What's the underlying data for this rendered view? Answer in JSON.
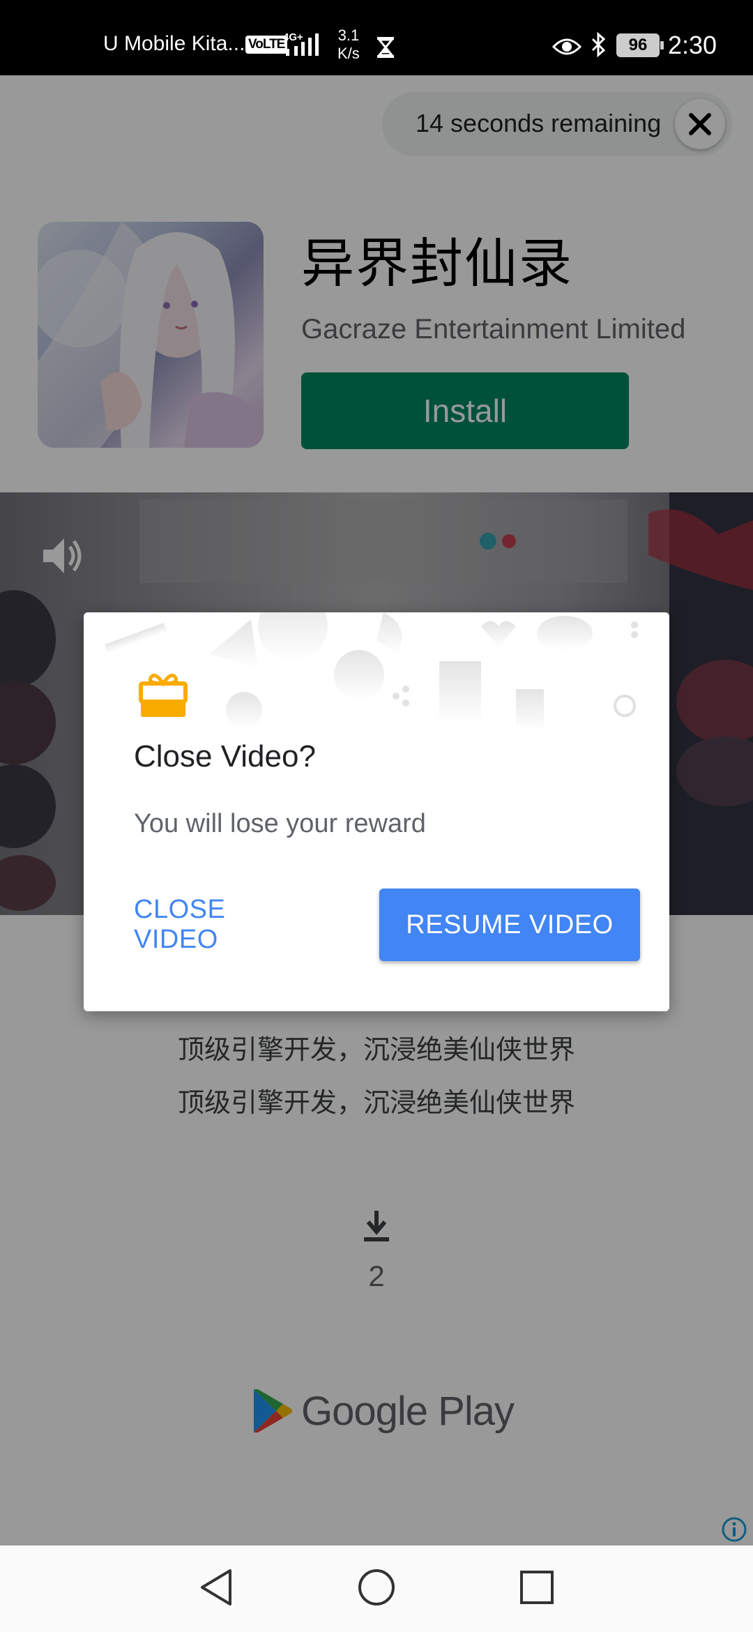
{
  "status_bar": {
    "carrier": "U Mobile Kita...",
    "volte": "VoLTE",
    "network": "4G+",
    "speed_value": "3.1",
    "speed_unit": "K/s",
    "battery": "96",
    "time": "2:30"
  },
  "ad": {
    "timer_text": "14 seconds remaining",
    "app_title": "异界封仙录",
    "developer": "Gacraze Entertainment Limited",
    "install_label": "Install",
    "description_lines": [
      "顶级引擎开发，沉浸绝美仙侠世界",
      "顶级引擎开发，沉浸绝美仙侠世界"
    ],
    "download_count": "2",
    "store_label": "Google Play"
  },
  "dialog": {
    "title": "Close Video?",
    "message": "You will lose your reward",
    "close_label": "CLOSE VIDEO",
    "resume_label": "RESUME VIDEO"
  },
  "colors": {
    "install_green": "#01875f",
    "accent_blue": "#4285f4",
    "gift_yellow": "#f9ab00"
  },
  "icons": [
    "volte-icon",
    "signal-icon",
    "hourglass-icon",
    "eye-icon",
    "bluetooth-icon",
    "battery-icon",
    "close-icon",
    "speaker-icon",
    "gift-icon",
    "download-icon",
    "google-play-logo-icon",
    "ad-info-icon",
    "back-icon",
    "home-icon",
    "recents-icon"
  ]
}
